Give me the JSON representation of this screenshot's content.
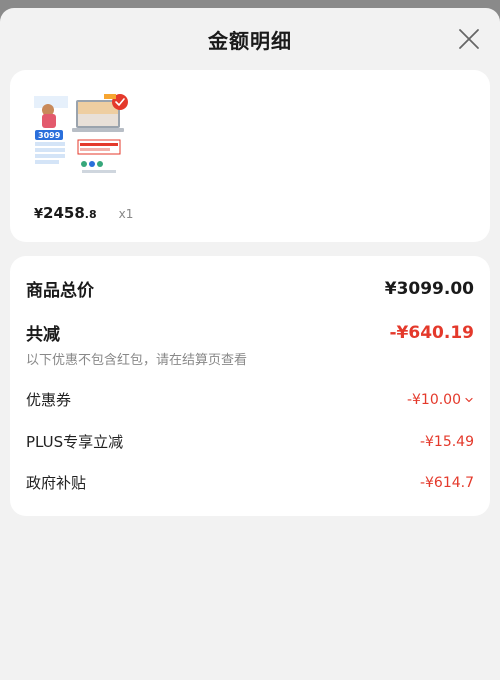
{
  "header": {
    "title": "金额明细"
  },
  "product": {
    "thumb_badge_price": "3099",
    "price_symbol": "¥",
    "price_int": "2458",
    "price_dec": ".8",
    "quantity": "x1"
  },
  "breakdown": {
    "total_label": "商品总价",
    "total_value": "¥3099.00",
    "reduce_label": "共减",
    "reduce_value": "-¥640.19",
    "note": "以下优惠不包含红包，请在结算页查看",
    "items": [
      {
        "label": "优惠券",
        "value": "-¥10.00"
      },
      {
        "label": "PLUS专享立减",
        "value": "-¥15.49"
      },
      {
        "label": "政府补贴",
        "value": "-¥614.7"
      }
    ]
  },
  "colors": {
    "accent_red": "#e4392b",
    "background": "#f2f2f2",
    "card": "#ffffff"
  },
  "icons": {
    "close": "close-icon",
    "coupon_expand": "chevron-down-icon"
  }
}
